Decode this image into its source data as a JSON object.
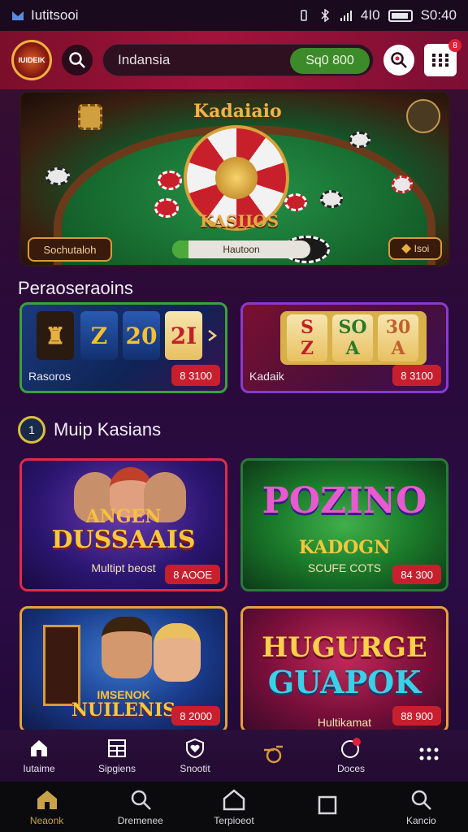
{
  "status_bar": {
    "app_name": "Iutitsooi",
    "time": "S0:40",
    "signal": "4I0"
  },
  "header": {
    "logo_text": "IUIDEIK",
    "search": {
      "value": "Indansia"
    },
    "balance": "Sq0 800",
    "calendar_badge": "8"
  },
  "hero": {
    "title": "Kadaiaio",
    "subtitle": "KASIIOS",
    "left_button": "Sochutaloh",
    "progress_label": "Hautoon",
    "progress_percent": 12,
    "right_button": "Isoi"
  },
  "section_1": {
    "title": "Peraoseraoins"
  },
  "slot_cards": [
    {
      "label": "Rasoros",
      "price": "8 3100",
      "reels": [
        "Z",
        "20",
        "2I"
      ]
    },
    {
      "label": "Kadaik",
      "price": "8 3100",
      "reels_top": [
        "S",
        "SO",
        "30"
      ],
      "reels_bottom": [
        "Z",
        "A",
        "A"
      ]
    }
  ],
  "section_2": {
    "badge": "1",
    "title": "Muip Kasians"
  },
  "games": [
    {
      "title_top": "ANGEN",
      "title": "DUSSAAIS",
      "subtitle": "Multipt beost",
      "price": "8 AOOE"
    },
    {
      "title": "POZINO",
      "subtitle_top": "KADOGN",
      "subtitle": "SCUFE COTS",
      "price": "84 300"
    },
    {
      "title": "NUILENIS",
      "subtitle": "IMSENOK",
      "price": "8 2000"
    },
    {
      "title": "HUGURGE",
      "title_bottom": "GUAPOK",
      "subtitle": "Hultikamat",
      "price": "88 900"
    }
  ],
  "app_tabs": [
    {
      "label": "Iutaime",
      "icon": "home-icon"
    },
    {
      "label": "Sipgiens",
      "icon": "grid-icon"
    },
    {
      "label": "Snootit",
      "icon": "shield-heart-icon"
    },
    {
      "label": "",
      "icon": "whistle-icon"
    },
    {
      "label": "Doces",
      "icon": "notification-icon"
    },
    {
      "label": "",
      "icon": "more-icon"
    }
  ],
  "sys_nav": [
    {
      "label": "Neaonk",
      "icon": "home-icon"
    },
    {
      "label": "Dremenee",
      "icon": "search-icon"
    },
    {
      "label": "Terpioeot",
      "icon": "house-outline-icon"
    },
    {
      "label": "",
      "icon": "square-icon"
    },
    {
      "label": "Kancio",
      "icon": "search-icon"
    }
  ],
  "colors": {
    "header": "#a4123a",
    "balance_pill": "#3d8a2a",
    "price_badge": "#c81f2e",
    "accent_gold": "#d8a03a"
  }
}
